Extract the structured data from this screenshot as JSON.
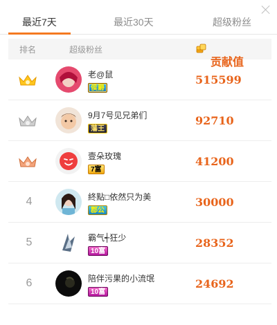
{
  "tabs": [
    {
      "label": "最近7天",
      "active": true
    },
    {
      "label": "最近30天",
      "active": false
    },
    {
      "label": "超级粉丝",
      "active": false
    }
  ],
  "table": {
    "headers": {
      "rank": "排名",
      "fan": "超级粉丝",
      "contribution": "贡献值"
    },
    "rows": [
      {
        "rank": "1",
        "rank_icon": "gold-crown-icon",
        "name": "老@鼠",
        "badge": "侯爵",
        "contribution": "515599"
      },
      {
        "rank": "2",
        "rank_icon": "silver-crown-icon",
        "name": "9月7号见兄弟们",
        "badge": "藩王",
        "contribution": "92710"
      },
      {
        "rank": "3",
        "rank_icon": "bronze-crown-icon",
        "name": "壹朵玫瑰",
        "badge": "7富",
        "contribution": "41200"
      },
      {
        "rank": "4",
        "rank_icon": "",
        "name": "終點□依然只为美",
        "badge": "郡公",
        "contribution": "30000"
      },
      {
        "rank": "5",
        "rank_icon": "",
        "name": "霸气┽狂少",
        "badge": "10富",
        "contribution": "28352"
      },
      {
        "rank": "6",
        "rank_icon": "",
        "name": "陪伴污果的小流氓",
        "badge": "10富",
        "contribution": "24692"
      }
    ]
  },
  "colors": {
    "accent": "#f47920",
    "contribution": "#e8641b"
  }
}
